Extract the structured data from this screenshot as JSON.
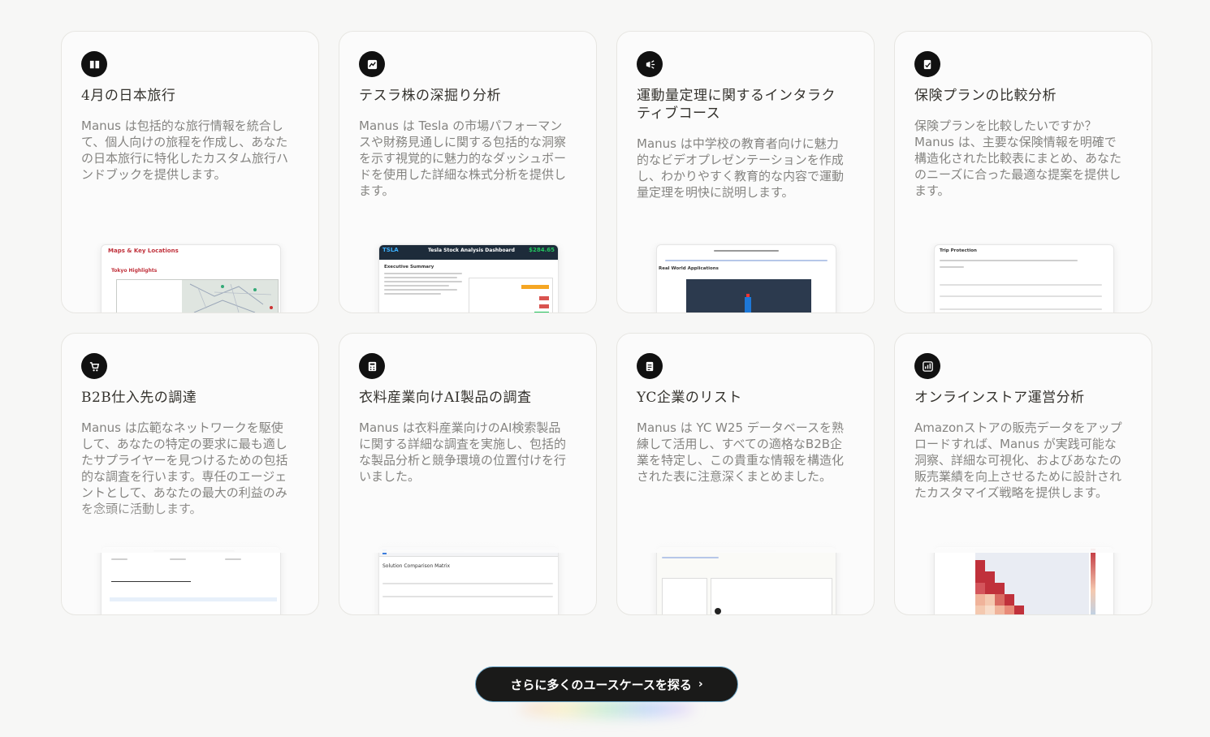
{
  "cards": [
    {
      "icon": "book-icon",
      "title": "4月の日本旅行",
      "desc": "Manus は包括的な旅行情報を統合して、個人向けの旅程を作成し、あなたの日本旅行に特化したカスタム旅行ハンドブックを提供します。",
      "preview_title": "Maps & Key Locations",
      "preview_sub": "Tokyo Highlights"
    },
    {
      "icon": "chart-image-icon",
      "title": "テスラ株の深掘り分析",
      "desc": "Manus は Tesla の市場パフォーマンスや財務見通しに関する包括的な洞察を示す視覚的に魅力的なダッシュボードを使用した詳細な株式分析を提供します。",
      "preview_title": "Tesla Stock Analysis Dashboard",
      "preview_sub": "TSLA",
      "preview_price": "$284.65",
      "preview_section": "Executive Summary"
    },
    {
      "icon": "megaphone-icon",
      "title": "運動量定理に関するインタラクティブコース",
      "desc": "Manus は中学校の教育者向けに魅力的なビデオプレゼンテーションを作成し、わかりやすく教育的な内容で運動量定理を明快に説明します。",
      "preview_title": "Real World Applications"
    },
    {
      "icon": "document-check-icon",
      "title": "保険プランの比較分析",
      "desc": "保険プランを比較したいですか？Manus は、主要な保険情報を明確で構造化された比較表にまとめ、あなたのニーズに合った最適な提案を提供します。",
      "preview_title": "Trip Protection"
    },
    {
      "icon": "cart-icon",
      "title": "B2B仕入先の調達",
      "desc": "Manus は広範なネットワークを駆使して、あなたの特定の要求に最も適したサプライヤーを見つけるための包括的な調査を行います。専任のエージェントとして、あなたの最大の利益のみを念頭に活動します。",
      "preview_title": ""
    },
    {
      "icon": "calculator-icon",
      "title": "衣料産業向けAI製品の調査",
      "desc": "Manus は衣料産業向けのAI検索製品に関する詳細な調査を実施し、包括的な製品分析と競争環境の位置付けを行いました。",
      "preview_title": "Solution Comparison Matrix"
    },
    {
      "icon": "document-list-icon",
      "title": "YC企業のリスト",
      "desc": "Manus は YC W25 データベースを熟練して活用し、すべての適格なB2B企業を特定し、この貴重な情報を構造化された表に注意深くまとめました。",
      "preview_title": ""
    },
    {
      "icon": "analytics-icon",
      "title": "オンラインストア運営分析",
      "desc": "Amazonストアの販売データをアップロードすれば、Manus が実践可能な洞察、詳細な可視化、およびあなたの販売業績を向上させるために設計されたカスタマイズ戦略を提供します。",
      "preview_title": ""
    }
  ],
  "cta": {
    "label": "さらに多くのユースケースを探る",
    "chevron": "›"
  },
  "colors": {
    "badge": "#111111",
    "cta_bg": "#1a1a19",
    "tesla_header": "#1d2b3a",
    "tesla_price": "#22c55e",
    "heatmap_red": "#c0313b"
  }
}
